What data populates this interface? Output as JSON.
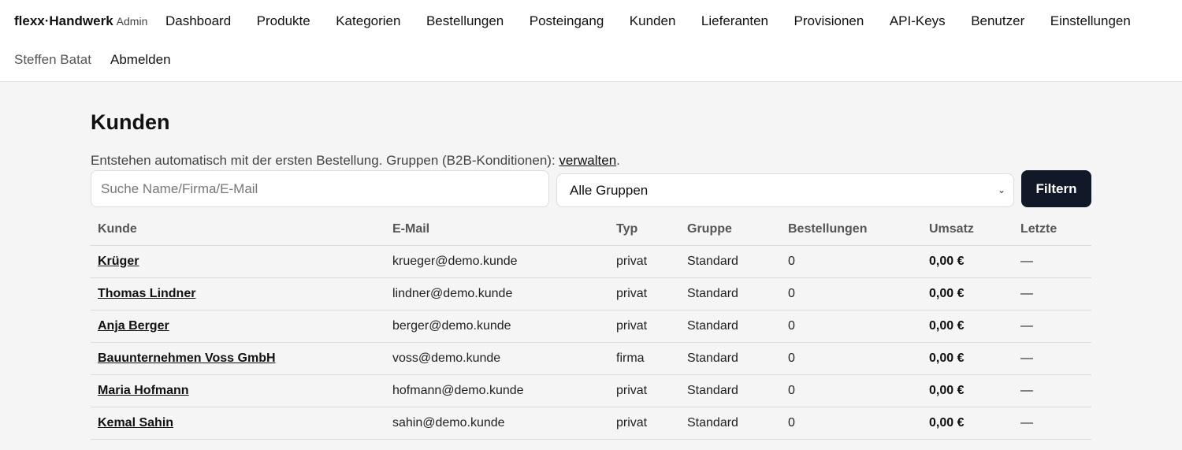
{
  "brand": {
    "name": "flexx·Handwerk",
    "sub": "Admin"
  },
  "nav": [
    {
      "key": "dashboard",
      "label": "Dashboard"
    },
    {
      "key": "produkte",
      "label": "Produkte"
    },
    {
      "key": "kategorien",
      "label": "Kategorien"
    },
    {
      "key": "bestellungen",
      "label": "Bestellungen"
    },
    {
      "key": "posteingang",
      "label": "Posteingang"
    },
    {
      "key": "kunden",
      "label": "Kunden"
    },
    {
      "key": "lieferanten",
      "label": "Lieferanten"
    },
    {
      "key": "provisionen",
      "label": "Provisionen"
    },
    {
      "key": "api-keys",
      "label": "API-Keys"
    },
    {
      "key": "benutzer",
      "label": "Benutzer"
    },
    {
      "key": "einstellungen",
      "label": "Einstellungen"
    }
  ],
  "user": {
    "name": "Steffen Batat",
    "logout": "Abmelden"
  },
  "page": {
    "title": "Kunden",
    "intro_text": "Entstehen automatisch mit der ersten Bestellung. Gruppen (B2B-Konditionen): ",
    "intro_link": "verwalten",
    "intro_end": "."
  },
  "filters": {
    "search_placeholder": "Suche Name/Firma/E-Mail",
    "search_value": "",
    "group_selected": "Alle Gruppen",
    "filter_button": "Filtern"
  },
  "table": {
    "headers": [
      "Kunde",
      "E-Mail",
      "Typ",
      "Gruppe",
      "Bestellungen",
      "Umsatz",
      "Letzte"
    ],
    "rows": [
      {
        "name": "Krüger",
        "email": "krueger@demo.kunde",
        "type": "privat",
        "group": "Standard",
        "orders": "0",
        "revenue": "0,00 €",
        "last": "—"
      },
      {
        "name": "Thomas Lindner",
        "email": "lindner@demo.kunde",
        "type": "privat",
        "group": "Standard",
        "orders": "0",
        "revenue": "0,00 €",
        "last": "—"
      },
      {
        "name": "Anja Berger",
        "email": "berger@demo.kunde",
        "type": "privat",
        "group": "Standard",
        "orders": "0",
        "revenue": "0,00 €",
        "last": "—"
      },
      {
        "name": "Bauunternehmen Voss GmbH",
        "email": "voss@demo.kunde",
        "type": "firma",
        "group": "Standard",
        "orders": "0",
        "revenue": "0,00 €",
        "last": "—"
      },
      {
        "name": "Maria Hofmann",
        "email": "hofmann@demo.kunde",
        "type": "privat",
        "group": "Standard",
        "orders": "0",
        "revenue": "0,00 €",
        "last": "—"
      },
      {
        "name": "Kemal Sahin",
        "email": "sahin@demo.kunde",
        "type": "privat",
        "group": "Standard",
        "orders": "0",
        "revenue": "0,00 €",
        "last": "—"
      }
    ]
  }
}
